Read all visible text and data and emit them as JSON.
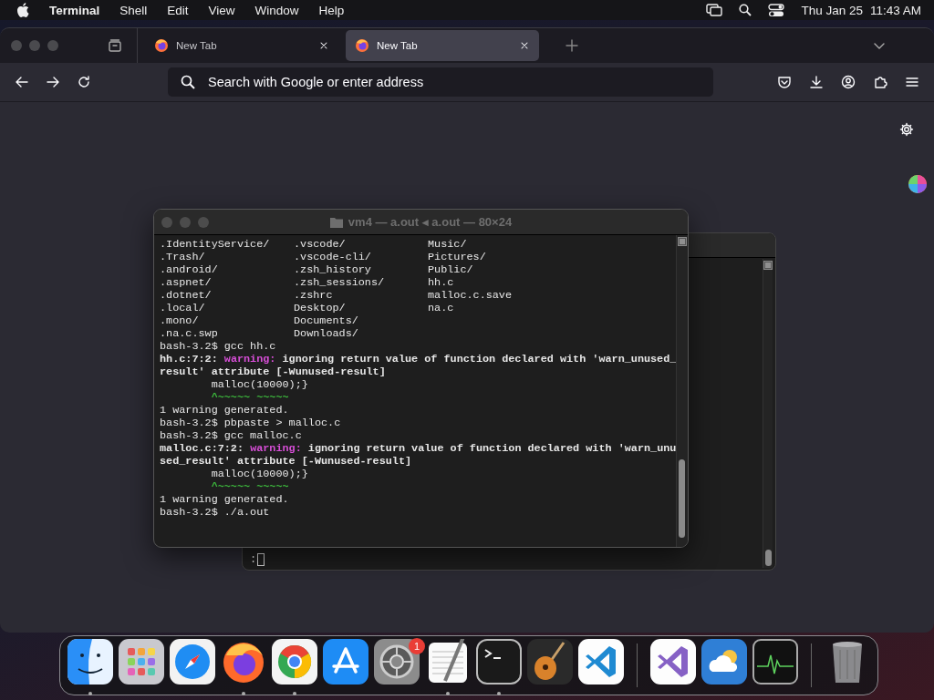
{
  "menubar": {
    "app": "Terminal",
    "menus": [
      "Shell",
      "Edit",
      "View",
      "Window",
      "Help"
    ],
    "date": "Thu Jan 25",
    "time": "11:43 AM"
  },
  "browser": {
    "tabs": [
      {
        "label": "New Tab",
        "selected": false
      },
      {
        "label": "New Tab",
        "selected": true
      }
    ],
    "address": {
      "placeholder": "Search with Google or enter address"
    }
  },
  "terminal": {
    "title": "vm4 — a.out ◂ a.out — 80×24",
    "listing": [
      [
        ".IdentityService/",
        ".vscode/",
        "Music/"
      ],
      [
        ".Trash/",
        ".vscode-cli/",
        "Pictures/"
      ],
      [
        ".android/",
        ".zsh_history",
        "Public/"
      ],
      [
        ".aspnet/",
        ".zsh_sessions/",
        "hh.c"
      ],
      [
        ".dotnet/",
        ".zshrc",
        "malloc.c.save"
      ],
      [
        ".local/",
        "Desktop/",
        "na.c"
      ],
      [
        ".mono/",
        "Documents/"
      ],
      [
        ".na.c.swp",
        "Downloads/"
      ]
    ],
    "lines": [
      {
        "kind": "prompt",
        "text": "bash-3.2$ gcc hh.c"
      },
      {
        "kind": "diagnostic",
        "location": "hh.c:7:2:",
        "severity": "warning:",
        "message": "ignoring return value of function declared with 'warn_unused_"
      },
      {
        "kind": "bold",
        "text": "result' attribute [-Wunused-result]"
      },
      {
        "kind": "plain",
        "text": "        malloc(10000);}"
      },
      {
        "kind": "caret",
        "text": "        ^~~~~~ ~~~~~"
      },
      {
        "kind": "plain",
        "text": "1 warning generated."
      },
      {
        "kind": "prompt",
        "text": "bash-3.2$ pbpaste > malloc.c"
      },
      {
        "kind": "prompt",
        "text": "bash-3.2$ gcc malloc.c"
      },
      {
        "kind": "diagnostic",
        "location": "malloc.c:7:2:",
        "severity": "warning:",
        "message": "ignoring return value of function declared with 'warn_unu"
      },
      {
        "kind": "bold",
        "text": "sed_result' attribute [-Wunused-result]"
      },
      {
        "kind": "plain",
        "text": "        malloc(10000);}"
      },
      {
        "kind": "caret",
        "text": "        ^~~~~~ ~~~~~"
      },
      {
        "kind": "plain",
        "text": "1 warning generated."
      },
      {
        "kind": "prompt",
        "text": "bash-3.2$ ./a.out"
      }
    ]
  },
  "back_terminal": {
    "prompt": ":"
  },
  "dock": {
    "apps": [
      {
        "kind": "finder",
        "running": true
      },
      {
        "kind": "launchpad",
        "running": false
      },
      {
        "kind": "safari",
        "running": false
      },
      {
        "kind": "firefox",
        "running": true
      },
      {
        "kind": "chrome",
        "running": true
      },
      {
        "kind": "appstore",
        "running": false
      },
      {
        "kind": "settings",
        "running": false,
        "badge": "1"
      },
      {
        "kind": "textedit",
        "running": true
      },
      {
        "kind": "terminal",
        "running": true
      },
      {
        "kind": "guitar",
        "running": false
      },
      {
        "kind": "vscode",
        "running": false
      },
      {
        "kind": "separator"
      },
      {
        "kind": "visualstudio",
        "running": false
      },
      {
        "kind": "weather",
        "running": false
      },
      {
        "kind": "monitor",
        "running": false
      },
      {
        "kind": "separator"
      },
      {
        "kind": "trash",
        "running": false
      }
    ]
  }
}
